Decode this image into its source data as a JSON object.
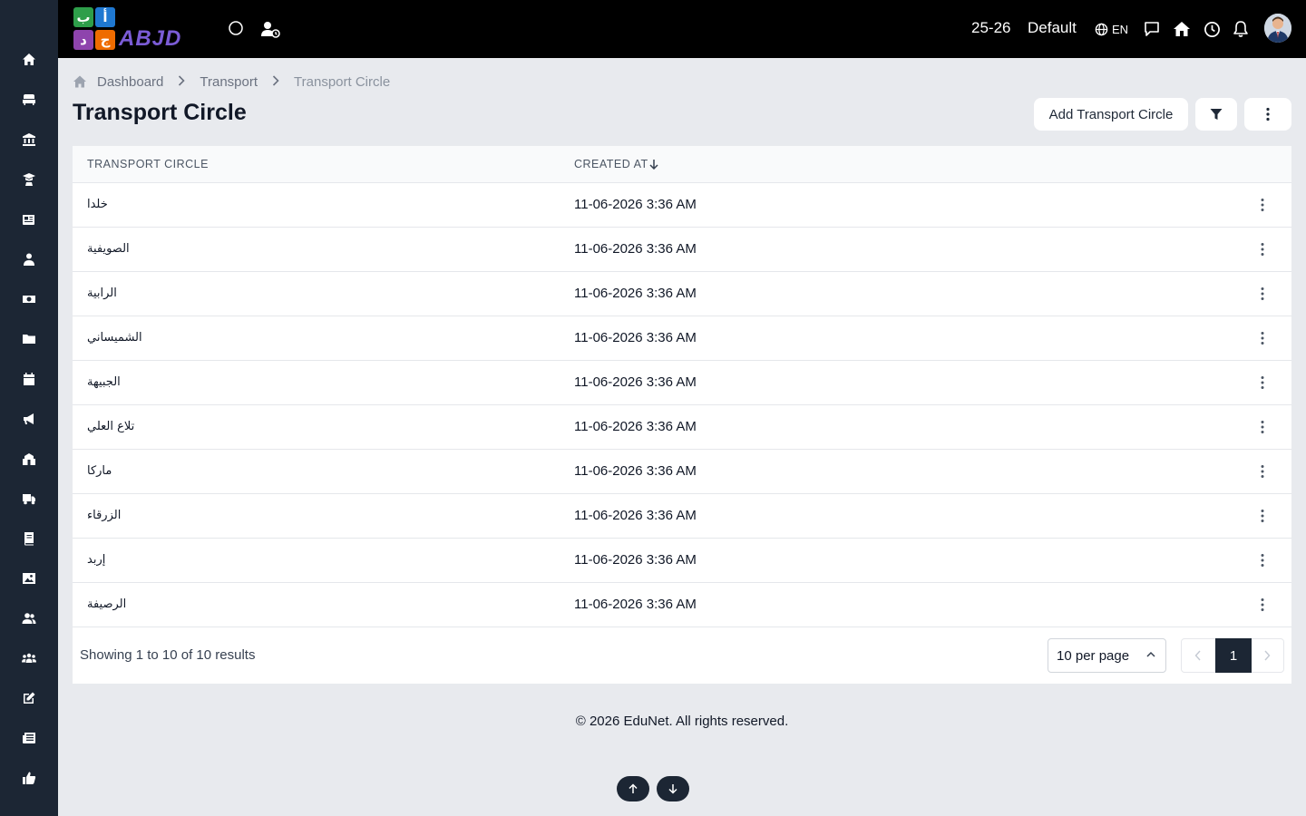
{
  "topbar": {
    "logo": {
      "letters": [
        "ب",
        "أ",
        "د",
        "ج"
      ],
      "word": "ABJD",
      "colors": [
        "#e91e63",
        "#2196f3",
        "#9c27b0",
        "#ff9800"
      ]
    },
    "year": "25-26",
    "profile": "Default",
    "language": "EN",
    "icons": [
      "loading-circle-icon",
      "user-clock-icon",
      "globe-icon",
      "chat-icon",
      "home-icon",
      "clock-icon",
      "bell-icon",
      "avatar"
    ]
  },
  "sidebar": {
    "items": [
      "home-icon",
      "sofa-icon",
      "bank-icon",
      "graduation-icon",
      "newspaper-icon",
      "teacher-icon",
      "money-icon",
      "folder-icon",
      "calendar-icon",
      "megaphone-icon",
      "school-icon",
      "truck-icon",
      "book-icon",
      "image-icon",
      "users-icon",
      "groups-icon",
      "edit-icon",
      "news-icon",
      "thumbs-up-icon"
    ]
  },
  "breadcrumb": {
    "items": [
      "Dashboard",
      "Transport",
      "Transport Circle"
    ]
  },
  "page": {
    "title": "Transport Circle",
    "add_button": "Add Transport Circle"
  },
  "table": {
    "headers": {
      "name": "TRANSPORT CIRCLE",
      "created": "CREATED AT"
    },
    "rows": [
      {
        "name": "خلدا",
        "created": "11-06-2026 3:36 AM"
      },
      {
        "name": "الصويفية",
        "created": "11-06-2026 3:36 AM"
      },
      {
        "name": "الرابية",
        "created": "11-06-2026 3:36 AM"
      },
      {
        "name": "الشميساني",
        "created": "11-06-2026 3:36 AM"
      },
      {
        "name": "الجبيهة",
        "created": "11-06-2026 3:36 AM"
      },
      {
        "name": "تلاع العلي",
        "created": "11-06-2026 3:36 AM"
      },
      {
        "name": "ماركا",
        "created": "11-06-2026 3:36 AM"
      },
      {
        "name": "الزرقاء",
        "created": "11-06-2026 3:36 AM"
      },
      {
        "name": "إربد",
        "created": "11-06-2026 3:36 AM"
      },
      {
        "name": "الرصيفة",
        "created": "11-06-2026 3:36 AM"
      }
    ],
    "summary": "Showing 1 to 10 of 10 results",
    "per_page": "10 per page",
    "current_page": "1"
  },
  "footer": {
    "copyright": "© 2026 EduNet. All rights reserved."
  }
}
